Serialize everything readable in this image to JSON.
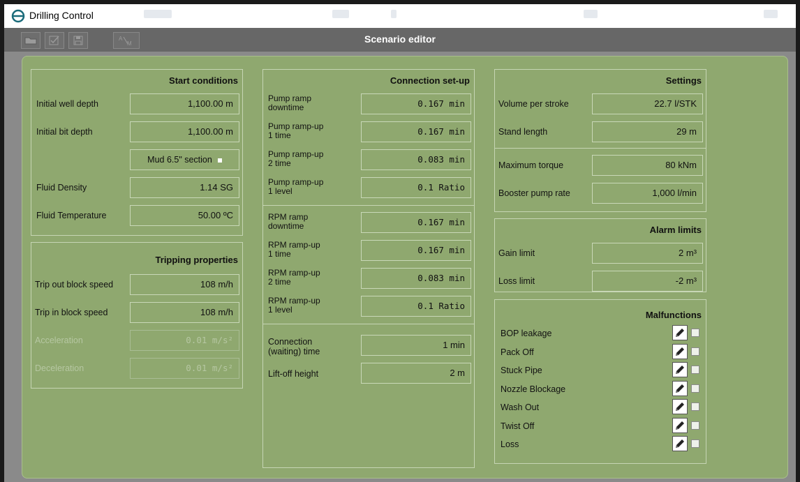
{
  "window": {
    "title": "Drilling Control"
  },
  "editor": {
    "title": "Scenario editor"
  },
  "toolbar": {
    "icons": [
      "open-icon",
      "validate-icon",
      "save-icon",
      "edit-text-icon"
    ]
  },
  "start_conditions": {
    "title": "Start conditions",
    "initial_well_depth": {
      "label": "Initial well depth",
      "value": "1,100.00 m"
    },
    "initial_bit_depth": {
      "label": "Initial bit depth",
      "value": "1,100.00 m"
    },
    "mud_section": {
      "value": "Mud 6.5\" section"
    },
    "fluid_density": {
      "label": "Fluid Density",
      "value": "1.14 SG"
    },
    "fluid_temperature": {
      "label": "Fluid Temperature",
      "value": "50.00 ºC"
    }
  },
  "tripping": {
    "title": "Tripping properties",
    "trip_out": {
      "label": "Trip out block speed",
      "value": "108 m/h"
    },
    "trip_in": {
      "label": "Trip in block speed",
      "value": "108 m/h"
    },
    "acceleration": {
      "label": "Acceleration",
      "value": "0.01 m/s²"
    },
    "deceleration": {
      "label": "Deceleration",
      "value": "0.01 m/s²"
    }
  },
  "connection": {
    "title": "Connection set-up",
    "pump_ramp_downtime": {
      "label1": "Pump ramp",
      "label2": "downtime",
      "value": "0.167 min"
    },
    "pump_rampup_1_time": {
      "label1": "Pump ramp-up",
      "label2": "1 time",
      "value": "0.167 min"
    },
    "pump_rampup_2_time": {
      "label1": "Pump ramp-up",
      "label2": "2 time",
      "value": "0.083 min"
    },
    "pump_rampup_1_level": {
      "label1": "Pump ramp-up",
      "label2": "1 level",
      "value": "0.1 Ratio"
    },
    "rpm_ramp_downtime": {
      "label1": "RPM ramp",
      "label2": "downtime",
      "value": "0.167 min"
    },
    "rpm_rampup_1_time": {
      "label1": "RPM ramp-up",
      "label2": "1 time",
      "value": "0.167 min"
    },
    "rpm_rampup_2_time": {
      "label1": "RPM ramp-up",
      "label2": "2 time",
      "value": "0.083 min"
    },
    "rpm_rampup_1_level": {
      "label1": "RPM ramp-up",
      "label2": "1 level",
      "value": "0.1 Ratio"
    },
    "connection_time": {
      "label1": "Connection",
      "label2": "(waiting) time",
      "value": "1 min"
    },
    "liftoff_height": {
      "label": "Lift-off height",
      "value": "2 m"
    }
  },
  "settings": {
    "title": "Settings",
    "volume_per_stroke": {
      "label": "Volume per stroke",
      "value": "22.7 l/STK"
    },
    "stand_length": {
      "label": "Stand length",
      "value": "29 m"
    },
    "maximum_torque": {
      "label": "Maximum torque",
      "value": "80 kNm"
    },
    "booster_pump_rate": {
      "label": "Booster pump rate",
      "value": "1,000 l/min"
    }
  },
  "alarm_limits": {
    "title": "Alarm limits",
    "gain_limit": {
      "label": "Gain limit",
      "value": "2 m³"
    },
    "loss_limit": {
      "label": "Loss limit",
      "value": "-2 m³"
    }
  },
  "malfunctions": {
    "title": "Malfunctions",
    "items": [
      {
        "label": "BOP leakage",
        "checked": false
      },
      {
        "label": "Pack Off",
        "checked": false
      },
      {
        "label": "Stuck Pipe",
        "checked": false
      },
      {
        "label": "Nozzle Blockage",
        "checked": false
      },
      {
        "label": "Wash Out",
        "checked": false
      },
      {
        "label": "Twist Off",
        "checked": false
      },
      {
        "label": "Loss",
        "checked": false
      }
    ]
  },
  "colors": {
    "panel": "#8fa86f",
    "toolbar": "#676767",
    "border": "#c6d5b4",
    "disabled_text": "#b6c7a2"
  }
}
